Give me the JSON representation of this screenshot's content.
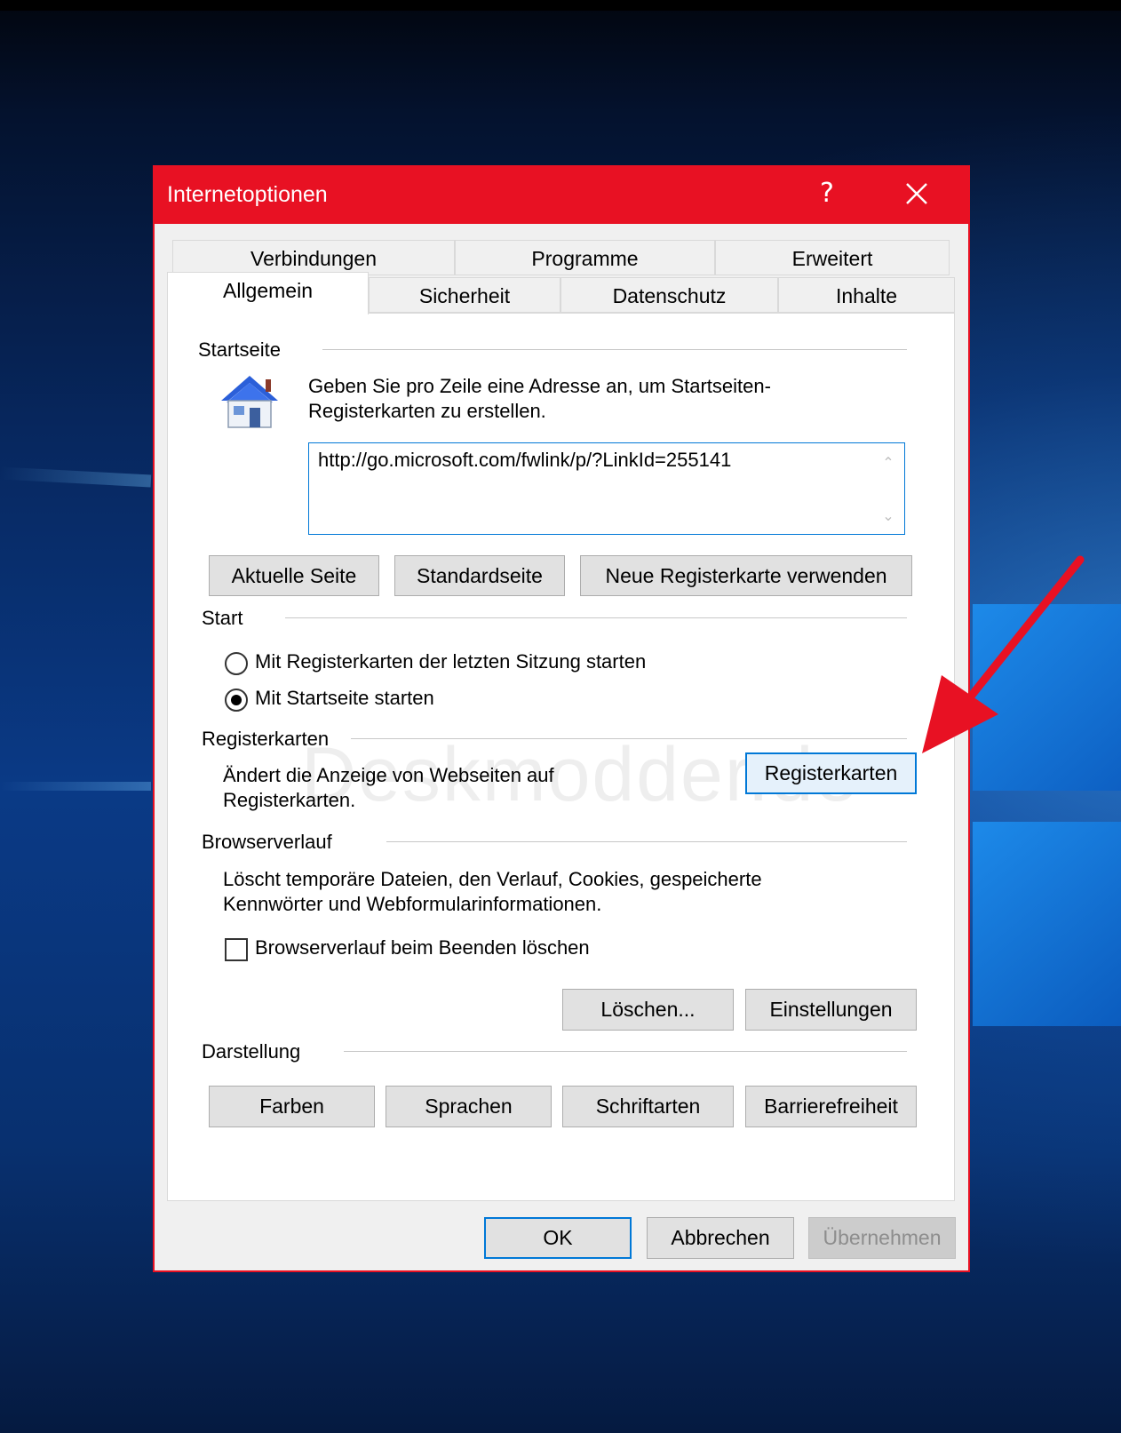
{
  "window": {
    "title": "Internetoptionen",
    "help_label": "?"
  },
  "tabs_row1": [
    "Verbindungen",
    "Programme",
    "Erweitert"
  ],
  "tabs_row2": [
    "Allgemein",
    "Sicherheit",
    "Datenschutz",
    "Inhalte"
  ],
  "startseite": {
    "group_label": "Startseite",
    "description_line1": "Geben Sie pro Zeile eine Adresse an, um Startseiten-",
    "description_line2": "Registerkarten zu erstellen.",
    "address_value": "http://go.microsoft.com/fwlink/p/?LinkId=255141",
    "buttons": [
      "Aktuelle Seite",
      "Standardseite",
      "Neue Registerkarte verwenden"
    ]
  },
  "start": {
    "group_label": "Start",
    "options": [
      {
        "label": "Mit Registerkarten der letzten Sitzung starten",
        "selected": false
      },
      {
        "label": "Mit Startseite starten",
        "selected": true
      }
    ]
  },
  "registerkarten": {
    "group_label": "Registerkarten",
    "description_line1": "Ändert die Anzeige von Webseiten auf",
    "description_line2": "Registerkarten.",
    "button": "Registerkarten"
  },
  "browserverlauf": {
    "group_label": "Browserverlauf",
    "description_line1": "Löscht temporäre Dateien, den Verlauf, Cookies, gespeicherte",
    "description_line2": "Kennwörter und Webformularinformationen.",
    "checkbox_label": "Browserverlauf beim Beenden löschen",
    "checkbox_checked": false,
    "delete_button": "Löschen...",
    "settings_button": "Einstellungen"
  },
  "darstellung": {
    "group_label": "Darstellung",
    "buttons": [
      "Farben",
      "Sprachen",
      "Schriftarten",
      "Barrierefreiheit"
    ]
  },
  "footer": {
    "ok": "OK",
    "cancel": "Abbrechen",
    "apply": "Übernehmen"
  },
  "watermark": "Deskmodder.de",
  "colors": {
    "titlebar": "#e81123",
    "focus": "#0078d7",
    "annotation_arrow": "#e81123"
  }
}
